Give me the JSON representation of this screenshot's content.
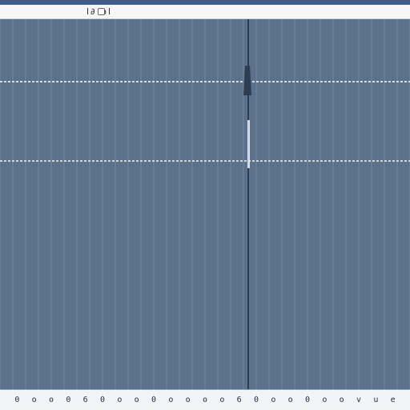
{
  "toolbar": {
    "label": "l∂ ol",
    "icon": "file-icon"
  },
  "ruler": {
    "labels": [
      "0",
      "o",
      "o",
      "0",
      "6",
      "0",
      "o",
      "o",
      "0",
      "o",
      "o",
      "o",
      "o",
      "6",
      "0",
      "o",
      "o",
      "0",
      "o",
      "o",
      "v",
      "u",
      "e"
    ]
  },
  "colors": {
    "background": "#5a6f88",
    "grid": "#7b8ea6",
    "accent": "#e8eef7",
    "cursor": "#3a4d63"
  }
}
